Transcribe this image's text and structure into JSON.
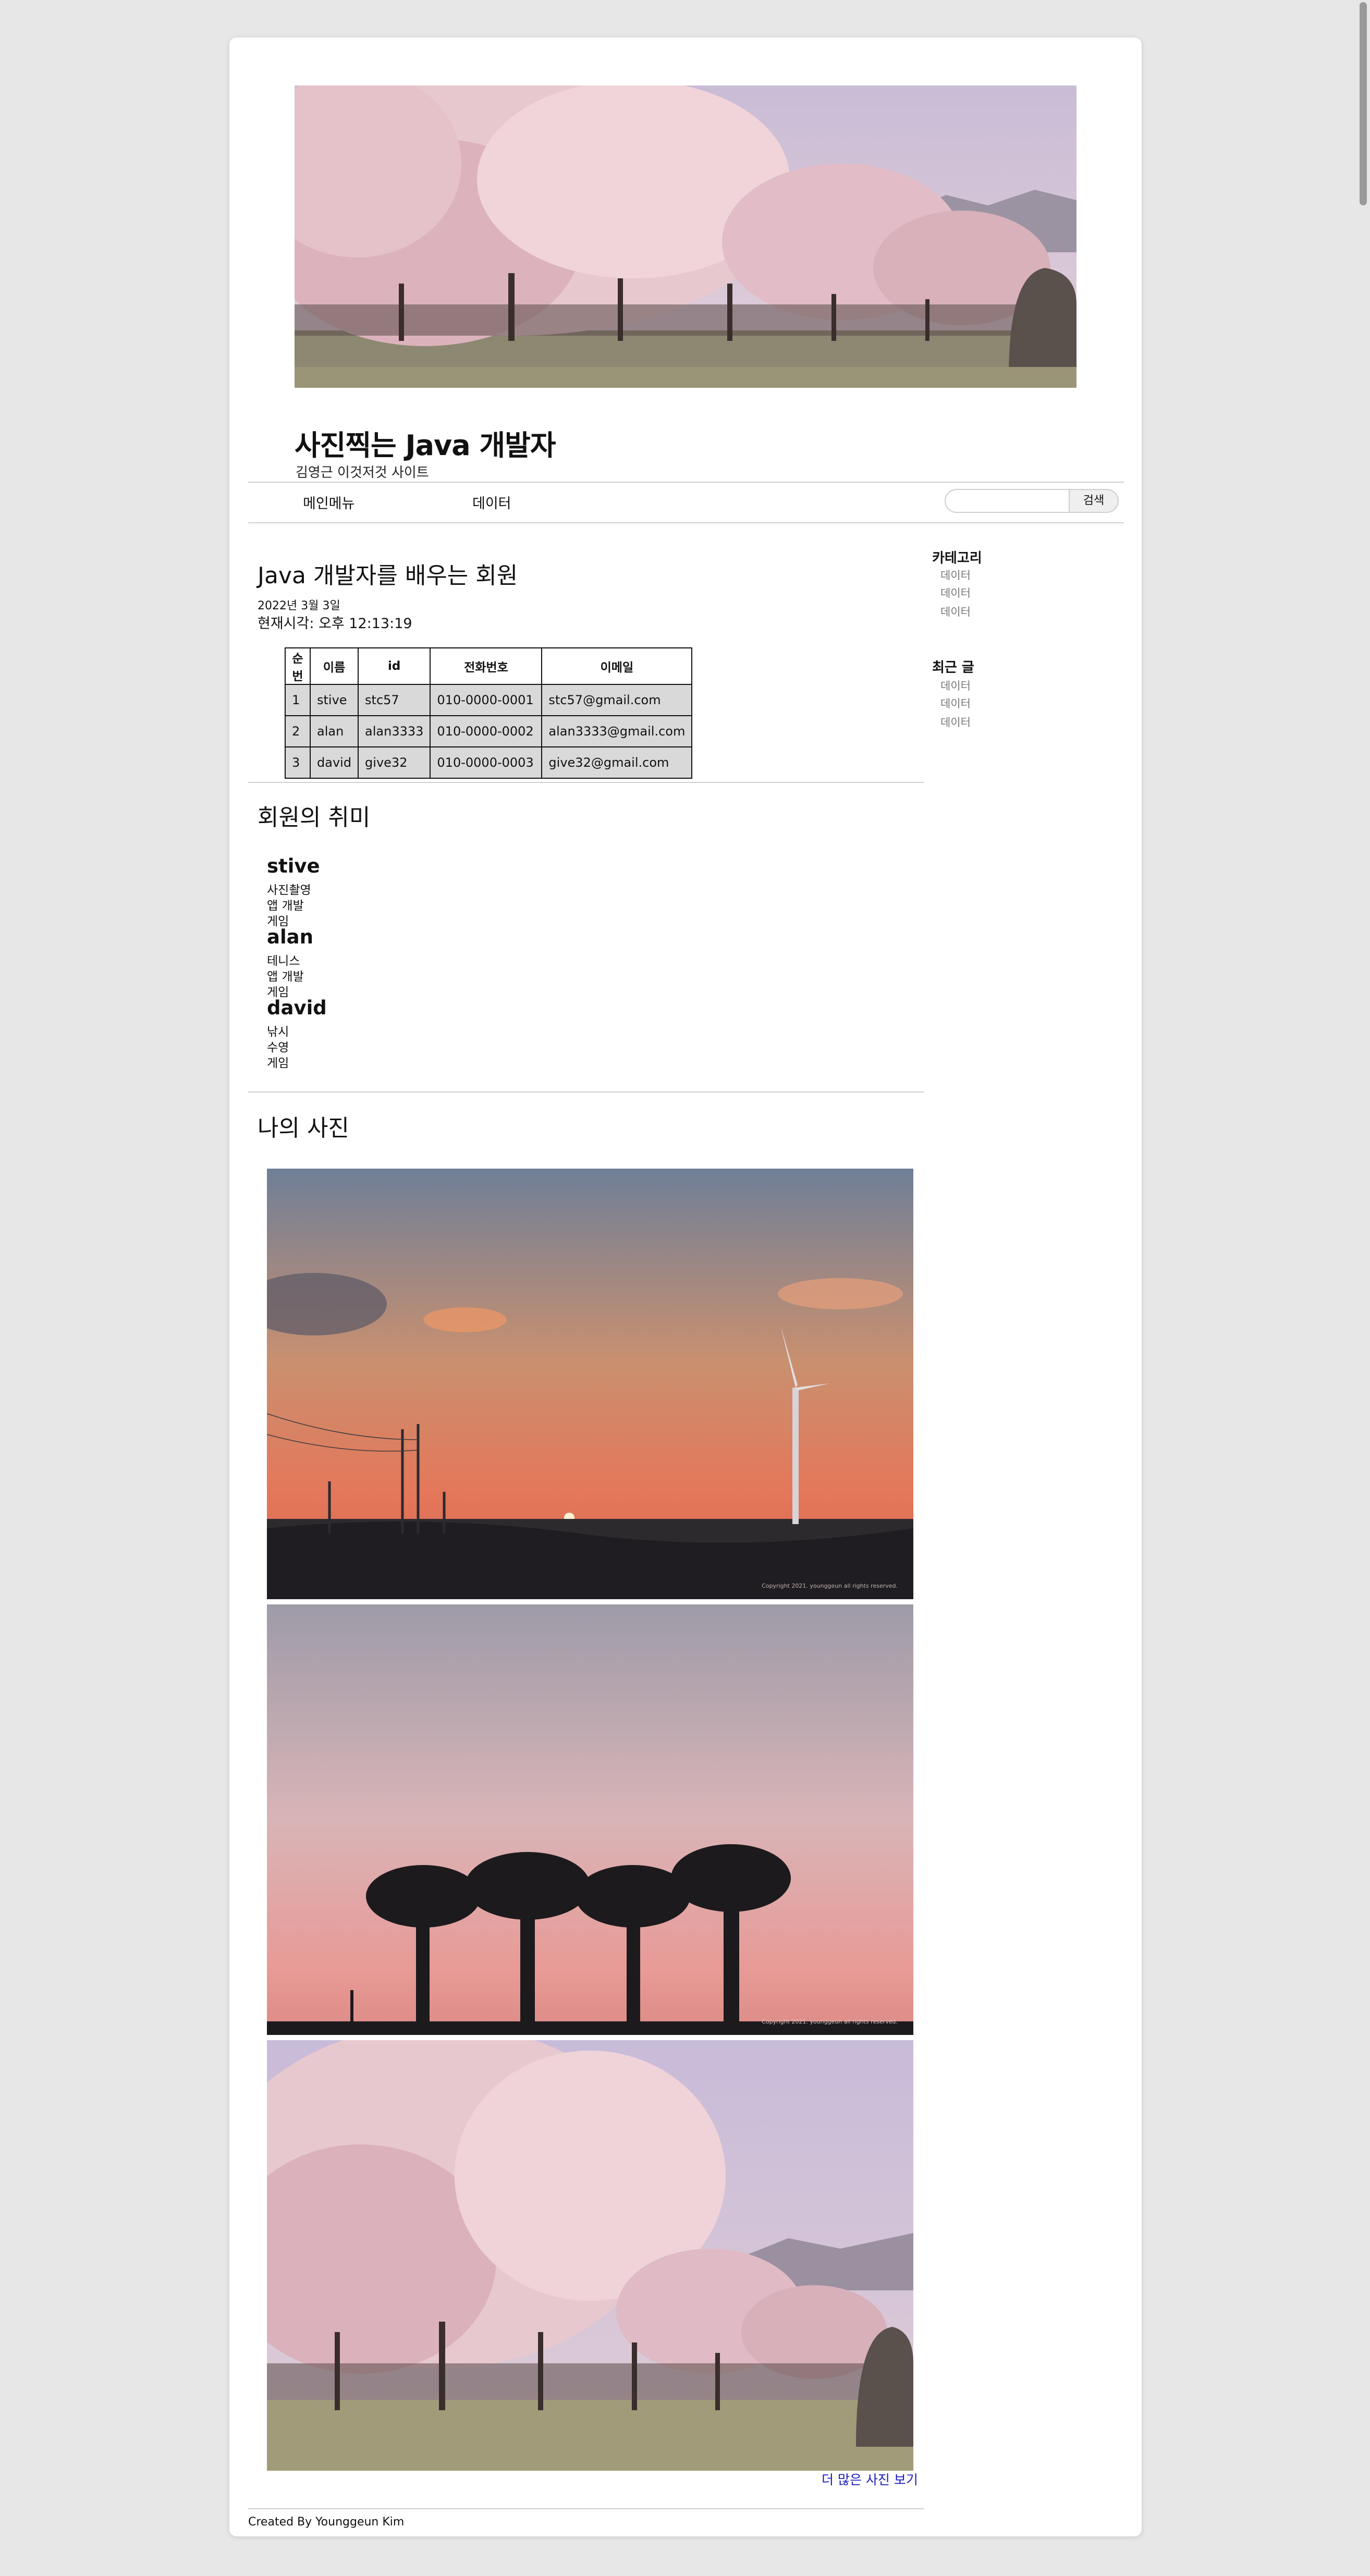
{
  "header": {
    "title": "사진찍는 Java 개발자",
    "subtitle": "김영근 이것저것 사이트"
  },
  "nav": {
    "items": [
      "메인메뉴",
      "데이터"
    ],
    "search_placeholder": "",
    "search_button": "검색"
  },
  "members": {
    "heading": "Java 개발자를 배우는 회원",
    "date": "2022년 3월 3일",
    "clock": "현재시각: 오후 12:13:19",
    "columns": [
      "순번",
      "이름",
      "id",
      "전화번호",
      "이메일"
    ],
    "rows": [
      [
        "1",
        "stive",
        "stc57",
        "010-0000-0001",
        "stc57@gmail.com"
      ],
      [
        "2",
        "alan",
        "alan3333",
        "010-0000-0002",
        "alan3333@gmail.com"
      ],
      [
        "3",
        "david",
        "give32",
        "010-0000-0003",
        "give32@gmail.com"
      ]
    ]
  },
  "hobbies": {
    "heading": "회원의 취미",
    "people": [
      {
        "name": "stive",
        "items": [
          "사진촬영",
          "앱 개발",
          "게임"
        ]
      },
      {
        "name": "alan",
        "items": [
          "테니스",
          "앱 개발",
          "게임"
        ]
      },
      {
        "name": "david",
        "items": [
          "낚시",
          "수영",
          "게임"
        ]
      }
    ]
  },
  "photos": {
    "heading": "나의 사진",
    "watermark": "Copyright 2021. younggeun all rights reserved.",
    "more_link": "더 많은 사진 보기"
  },
  "sidebar": {
    "categories": {
      "heading": "카테고리",
      "items": [
        "데이터",
        "데이터",
        "데이터"
      ]
    },
    "recent": {
      "heading": "최근 글",
      "items": [
        "데이터",
        "데이터",
        "데이터"
      ]
    }
  },
  "footer": {
    "text": "Created By Younggeun Kim"
  },
  "colors": {
    "link": "#1a1ab8",
    "table_cell_bg": "#d9d9d9",
    "page_bg": "#e7e7e7"
  }
}
